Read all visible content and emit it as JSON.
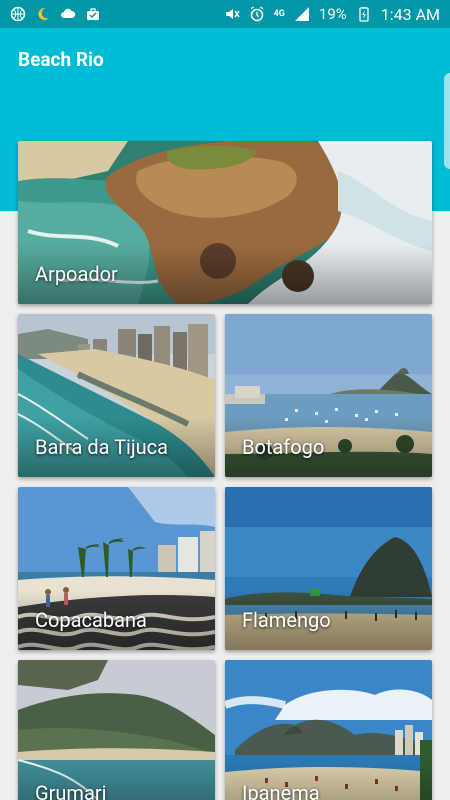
{
  "status_bar": {
    "battery_percent": "19%",
    "network": "4G",
    "time": "1:43 AM"
  },
  "app": {
    "title": "Beach Rio"
  },
  "beaches": [
    {
      "label": "Arpoador"
    },
    {
      "label": "Barra da Tijuca"
    },
    {
      "label": "Botafogo"
    },
    {
      "label": "Copacabana"
    },
    {
      "label": "Flamengo"
    },
    {
      "label": "Grumari"
    },
    {
      "label": "Ipanema"
    }
  ],
  "colors": {
    "status_bar": "#0097a7",
    "app_bar": "#00bcd4",
    "background": "#eeeeee"
  }
}
